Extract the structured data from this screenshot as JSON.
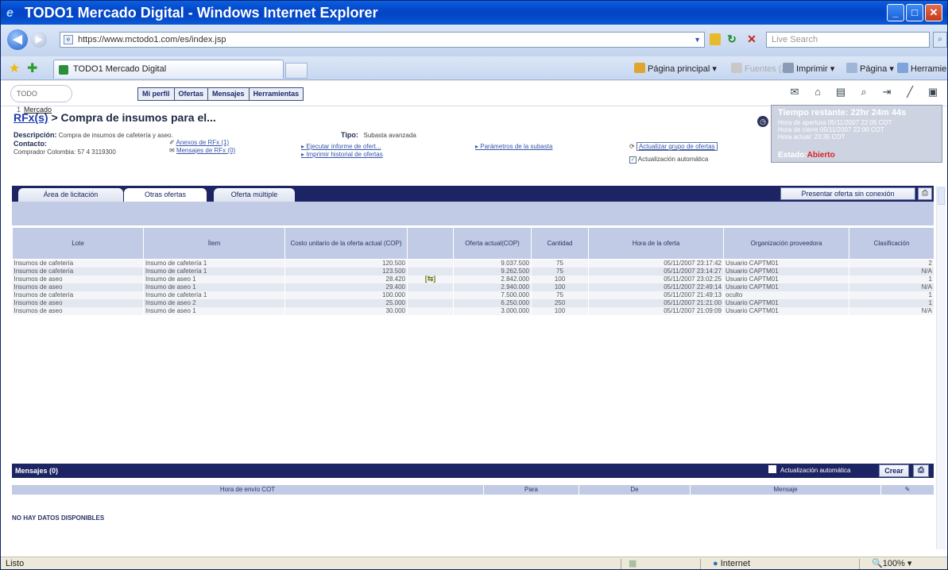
{
  "window": {
    "title": "TODO1 Mercado Digital - Windows Internet Explorer"
  },
  "address": {
    "url": "https://www.mctodo1.com/es/index.jsp",
    "search_placeholder": "Live Search"
  },
  "tab": {
    "label": "TODO1 Mercado Digital"
  },
  "commands": {
    "home": "Página principal",
    "feeds": "Fuentes (J)",
    "print": "Imprimir",
    "page": "Página",
    "tools": "Herramientas"
  },
  "app": {
    "logo_brand": "TODO 1",
    "logo_text": "Mercado",
    "menu": [
      "Mi perfil",
      "Ofertas",
      "Mensajes",
      "Herramientas"
    ],
    "breadcrumb_link": "RFx(s)",
    "breadcrumb_rest": " > Compra de insumos para el...",
    "desc_label": "Descripción:",
    "desc_value": "Compra de insumos de cafetería y aseo.",
    "contact_label": "Contacto:",
    "contact_value": "Comprador Colombia: 57 4 3119300",
    "tipo_label": "Tipo:",
    "tipo_value": "Subasta avanzada",
    "links": {
      "anexos": "Anexos de RFx (1)",
      "mensajes": "Mensajes de RFx (0)",
      "informe": "Ejecutar informe de ofert...",
      "historial": "Imprimir historial de ofertas",
      "parametros": "Parámetros de la subasta",
      "actualizar": "Actualizar grupo de ofertas",
      "auto": "Actualización automática"
    },
    "time": {
      "remaining": "Tiempo restante: 22hr 24m 44s",
      "open": "Hora de apertura 05/11/2007 22:05 COT",
      "close": "Hora de cierre 05/11/2007 22:00 COT",
      "current": "Hora actual: 23:35 COT",
      "estado_label": "Estado:",
      "estado_value": "Abierto"
    },
    "subtabs": [
      "Área de licitación",
      "Otras ofertas",
      "Oferta múltiple"
    ],
    "offline_button": "Presentar oferta sin conexión",
    "columns": [
      "Lote",
      "Ítem",
      "Costo unitario de la oferta actual (COP)",
      "",
      "Oferta actual(COP)",
      "Cantidad",
      "Hora de la oferta",
      "Organización proveedora",
      "Clasificación"
    ],
    "rows": [
      [
        "Insumos de cafetería",
        "Insumo de cafetería 1",
        "120.500",
        "",
        "9.037.500",
        "75",
        "05/11/2007 23:17:42",
        "Usuario CAPTM01",
        "2"
      ],
      [
        "Insumos de cafetería",
        "Insumo de cafetería 1",
        "123.500",
        "",
        "9.262.500",
        "75",
        "05/11/2007 23:14:27",
        "Usuario CAPTM01",
        "N/A"
      ],
      [
        "Insumos de aseo",
        "Insumo de aseo 1",
        "28.420",
        "swap",
        "2.842.000",
        "100",
        "05/11/2007 23:02:25",
        "Usuario CAPTM01",
        "1"
      ],
      [
        "Insumos de aseo",
        "Insumo de aseo 1",
        "29.400",
        "",
        "2.940.000",
        "100",
        "05/11/2007 22:49:14",
        "Usuario CAPTM01",
        "N/A"
      ],
      [
        "Insumos de cafetería",
        "Insumo de cafetería 1",
        "100.000",
        "",
        "7.500.000",
        "75",
        "05/11/2007 21:49:13",
        "oculto",
        "1"
      ],
      [
        "Insumos de aseo",
        "Insumo de aseo 2",
        "25.000",
        "",
        "6.250.000",
        "250",
        "05/11/2007 21:21:00",
        "Usuario CAPTM01",
        "1"
      ],
      [
        "Insumos de aseo",
        "Insumo de aseo 1",
        "30.000",
        "",
        "3.000.000",
        "100",
        "05/11/2007 21:09:09",
        "Usuario CAPTM01",
        "N/A"
      ]
    ],
    "messages": {
      "title": "Mensajes (0)",
      "auto": "Actualización automática",
      "create": "Crear",
      "columns": [
        "Hora de envío COT",
        "Para",
        "De",
        "Mensaje"
      ],
      "empty": "NO HAY DATOS DISPONIBLES"
    }
  },
  "status": {
    "left": "Listo",
    "zone": "Internet",
    "zoom": "100%"
  }
}
